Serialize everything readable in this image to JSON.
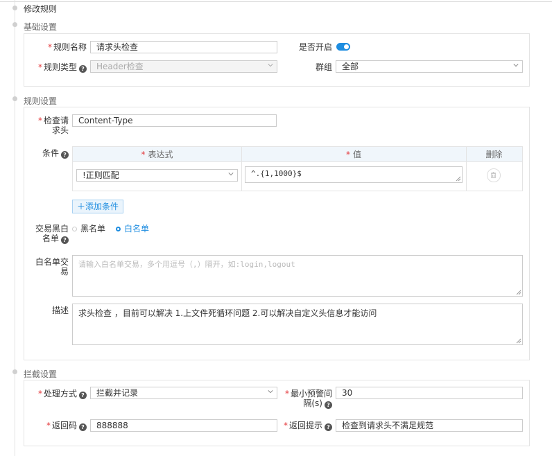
{
  "page_title": "修改规则",
  "sections": {
    "basic": "基础设置",
    "rule": "规则设置",
    "intercept": "拦截设置"
  },
  "basic": {
    "rule_name_label": "规则名称",
    "rule_name_value": "请求头检查",
    "enabled_label": "是否开启",
    "enabled": true,
    "rule_type_label": "规则类型",
    "rule_type_value": "Header检查",
    "group_label": "群组",
    "group_value": "全部"
  },
  "rule": {
    "check_header_label_1": "检查请",
    "check_header_label_2": "求头",
    "check_header_value": "Content-Type",
    "condition_label": "条件",
    "table": {
      "col_expression": "表达式",
      "col_value": "值",
      "col_delete": "删除",
      "rows": [
        {
          "expression": "!正则匹配",
          "value": "^.{1,1000}$"
        }
      ]
    },
    "add_condition": "添加条件",
    "blacklist_label_1": "交易黑白",
    "blacklist_label_2": "名单",
    "radio_black": "黑名单",
    "radio_white": "白名单",
    "selected": "white",
    "whitelist_label_1": "白名单交",
    "whitelist_label_2": "易",
    "whitelist_placeholder": "请输入白名单交易，多个用逗号（,）隔开，如:login,logout",
    "desc_label": "描述",
    "desc_value": "求头检查 ，目前可以解决 1.上文件死循环问题  2.可以解决自定义头信息才能访问"
  },
  "intercept": {
    "method_label": "处理方式",
    "method_value": "拦截并记录",
    "interval_label_1": "最小预警间",
    "interval_label_2": "隔(s)",
    "interval_value": "30",
    "code_label": "返回码",
    "code_value": "888888",
    "tip_label": "返回提示",
    "tip_value": "检查到请求头不满足规范"
  },
  "colors": {
    "accent": "#1e8de0",
    "required": "#e4393c"
  }
}
